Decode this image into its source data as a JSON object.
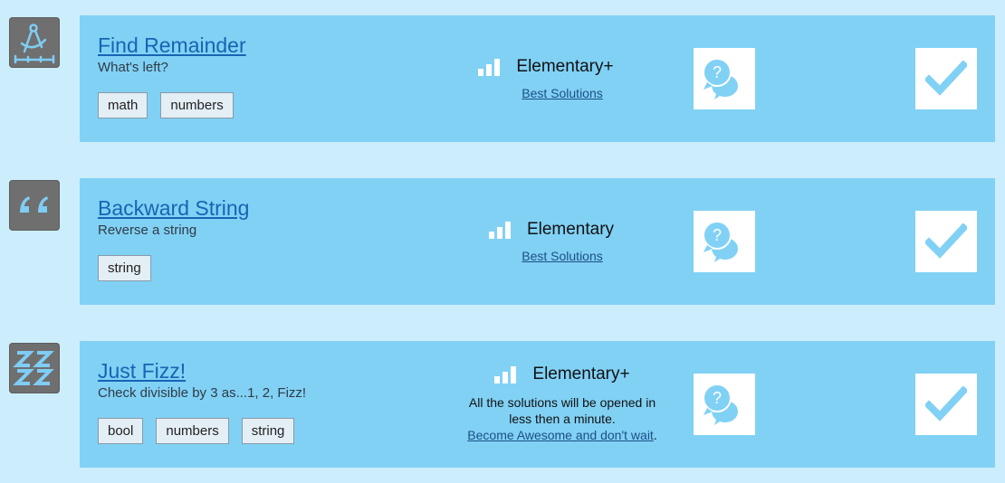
{
  "colors": {
    "page_bg": "#cceefc",
    "card_bg": "#81d1f5",
    "icon_tile": "#6f6f6f",
    "icon_glyph": "#7fcdf4",
    "link": "#1764b3"
  },
  "missions": [
    {
      "icon": "compass-ruler-icon",
      "title": "Find Remainder",
      "description": "What's left?",
      "tags": [
        "math",
        "numbers"
      ],
      "level": "Elementary+",
      "best_solutions": "Best Solutions"
    },
    {
      "icon": "quote-icon",
      "title": "Backward String",
      "description": "Reverse a string",
      "tags": [
        "string"
      ],
      "level": "Elementary",
      "best_solutions": "Best Solutions"
    },
    {
      "icon": "zzz-icon",
      "title": "Just Fizz!",
      "description": "Check divisible by 3 as...1, 2, Fizz!",
      "tags": [
        "bool",
        "numbers",
        "string"
      ],
      "level": "Elementary+",
      "note_line1": "All the solutions will be opened in",
      "note_line2": "less then a minute.",
      "note_link": "Become Awesome and don't wait",
      "note_end": "."
    }
  ]
}
